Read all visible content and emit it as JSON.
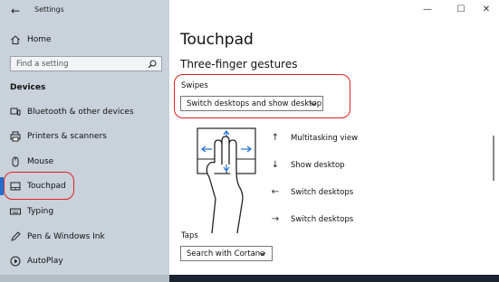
{
  "app": {
    "title": "Settings"
  },
  "sidebar": {
    "home_label": "Home",
    "search_placeholder": "Find a setting",
    "section_title": "Devices",
    "items": [
      {
        "label": "Bluetooth & other devices",
        "icon": "bluetooth-icon"
      },
      {
        "label": "Printers & scanners",
        "icon": "printer-icon"
      },
      {
        "label": "Mouse",
        "icon": "mouse-icon"
      },
      {
        "label": "Touchpad",
        "icon": "touchpad-icon",
        "selected": true
      },
      {
        "label": "Typing",
        "icon": "keyboard-icon"
      },
      {
        "label": "Pen & Windows Ink",
        "icon": "pen-icon"
      },
      {
        "label": "AutoPlay",
        "icon": "autoplay-icon"
      }
    ]
  },
  "window_controls": {
    "minimize": "—",
    "maximize": "☐",
    "close": "✕"
  },
  "main": {
    "page_title": "Touchpad",
    "section_title": "Three-finger gestures",
    "swipes": {
      "label": "Swipes",
      "value": "Switch desktops and show desktop"
    },
    "gestures": [
      {
        "arrow": "↑",
        "label": "Multitasking view"
      },
      {
        "arrow": "↓",
        "label": "Show desktop"
      },
      {
        "arrow": "←",
        "label": "Switch desktops"
      },
      {
        "arrow": "→",
        "label": "Switch desktops"
      }
    ],
    "taps": {
      "label": "Taps",
      "value": "Search with Cortana"
    }
  },
  "colors": {
    "sidebar_bg": "#c9d1da",
    "accent": "#1f6fd1",
    "highlight_circle": "#e02020"
  }
}
